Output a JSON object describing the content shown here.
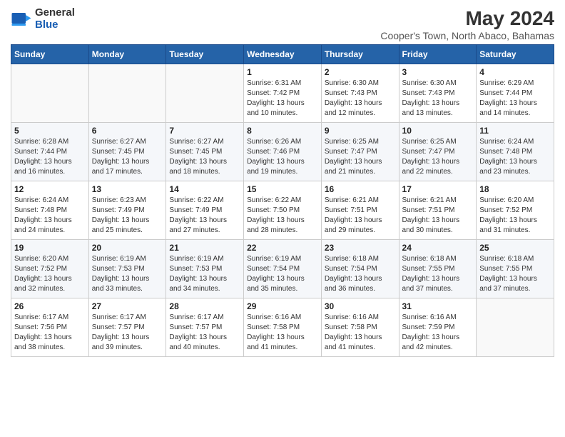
{
  "logo": {
    "general": "General",
    "blue": "Blue"
  },
  "title": "May 2024",
  "subtitle": "Cooper's Town, North Abaco, Bahamas",
  "days_header": [
    "Sunday",
    "Monday",
    "Tuesday",
    "Wednesday",
    "Thursday",
    "Friday",
    "Saturday"
  ],
  "weeks": [
    [
      {
        "day": "",
        "info": ""
      },
      {
        "day": "",
        "info": ""
      },
      {
        "day": "",
        "info": ""
      },
      {
        "day": "1",
        "info": "Sunrise: 6:31 AM\nSunset: 7:42 PM\nDaylight: 13 hours and 10 minutes."
      },
      {
        "day": "2",
        "info": "Sunrise: 6:30 AM\nSunset: 7:43 PM\nDaylight: 13 hours and 12 minutes."
      },
      {
        "day": "3",
        "info": "Sunrise: 6:30 AM\nSunset: 7:43 PM\nDaylight: 13 hours and 13 minutes."
      },
      {
        "day": "4",
        "info": "Sunrise: 6:29 AM\nSunset: 7:44 PM\nDaylight: 13 hours and 14 minutes."
      }
    ],
    [
      {
        "day": "5",
        "info": "Sunrise: 6:28 AM\nSunset: 7:44 PM\nDaylight: 13 hours and 16 minutes."
      },
      {
        "day": "6",
        "info": "Sunrise: 6:27 AM\nSunset: 7:45 PM\nDaylight: 13 hours and 17 minutes."
      },
      {
        "day": "7",
        "info": "Sunrise: 6:27 AM\nSunset: 7:45 PM\nDaylight: 13 hours and 18 minutes."
      },
      {
        "day": "8",
        "info": "Sunrise: 6:26 AM\nSunset: 7:46 PM\nDaylight: 13 hours and 19 minutes."
      },
      {
        "day": "9",
        "info": "Sunrise: 6:25 AM\nSunset: 7:47 PM\nDaylight: 13 hours and 21 minutes."
      },
      {
        "day": "10",
        "info": "Sunrise: 6:25 AM\nSunset: 7:47 PM\nDaylight: 13 hours and 22 minutes."
      },
      {
        "day": "11",
        "info": "Sunrise: 6:24 AM\nSunset: 7:48 PM\nDaylight: 13 hours and 23 minutes."
      }
    ],
    [
      {
        "day": "12",
        "info": "Sunrise: 6:24 AM\nSunset: 7:48 PM\nDaylight: 13 hours and 24 minutes."
      },
      {
        "day": "13",
        "info": "Sunrise: 6:23 AM\nSunset: 7:49 PM\nDaylight: 13 hours and 25 minutes."
      },
      {
        "day": "14",
        "info": "Sunrise: 6:22 AM\nSunset: 7:49 PM\nDaylight: 13 hours and 27 minutes."
      },
      {
        "day": "15",
        "info": "Sunrise: 6:22 AM\nSunset: 7:50 PM\nDaylight: 13 hours and 28 minutes."
      },
      {
        "day": "16",
        "info": "Sunrise: 6:21 AM\nSunset: 7:51 PM\nDaylight: 13 hours and 29 minutes."
      },
      {
        "day": "17",
        "info": "Sunrise: 6:21 AM\nSunset: 7:51 PM\nDaylight: 13 hours and 30 minutes."
      },
      {
        "day": "18",
        "info": "Sunrise: 6:20 AM\nSunset: 7:52 PM\nDaylight: 13 hours and 31 minutes."
      }
    ],
    [
      {
        "day": "19",
        "info": "Sunrise: 6:20 AM\nSunset: 7:52 PM\nDaylight: 13 hours and 32 minutes."
      },
      {
        "day": "20",
        "info": "Sunrise: 6:19 AM\nSunset: 7:53 PM\nDaylight: 13 hours and 33 minutes."
      },
      {
        "day": "21",
        "info": "Sunrise: 6:19 AM\nSunset: 7:53 PM\nDaylight: 13 hours and 34 minutes."
      },
      {
        "day": "22",
        "info": "Sunrise: 6:19 AM\nSunset: 7:54 PM\nDaylight: 13 hours and 35 minutes."
      },
      {
        "day": "23",
        "info": "Sunrise: 6:18 AM\nSunset: 7:54 PM\nDaylight: 13 hours and 36 minutes."
      },
      {
        "day": "24",
        "info": "Sunrise: 6:18 AM\nSunset: 7:55 PM\nDaylight: 13 hours and 37 minutes."
      },
      {
        "day": "25",
        "info": "Sunrise: 6:18 AM\nSunset: 7:55 PM\nDaylight: 13 hours and 37 minutes."
      }
    ],
    [
      {
        "day": "26",
        "info": "Sunrise: 6:17 AM\nSunset: 7:56 PM\nDaylight: 13 hours and 38 minutes."
      },
      {
        "day": "27",
        "info": "Sunrise: 6:17 AM\nSunset: 7:57 PM\nDaylight: 13 hours and 39 minutes."
      },
      {
        "day": "28",
        "info": "Sunrise: 6:17 AM\nSunset: 7:57 PM\nDaylight: 13 hours and 40 minutes."
      },
      {
        "day": "29",
        "info": "Sunrise: 6:16 AM\nSunset: 7:58 PM\nDaylight: 13 hours and 41 minutes."
      },
      {
        "day": "30",
        "info": "Sunrise: 6:16 AM\nSunset: 7:58 PM\nDaylight: 13 hours and 41 minutes."
      },
      {
        "day": "31",
        "info": "Sunrise: 6:16 AM\nSunset: 7:59 PM\nDaylight: 13 hours and 42 minutes."
      },
      {
        "day": "",
        "info": ""
      }
    ]
  ]
}
